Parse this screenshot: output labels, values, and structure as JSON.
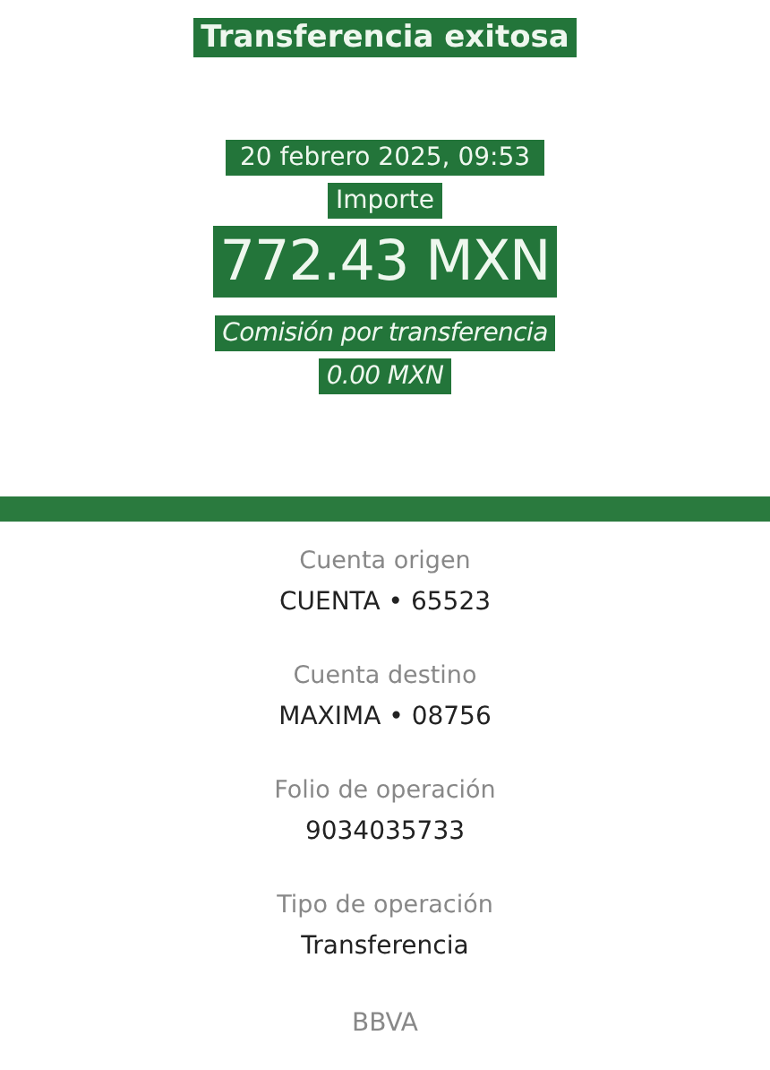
{
  "header": {
    "title": "Transferencia exitosa",
    "date": "20 febrero 2025, 09:53",
    "amount_label": "Importe",
    "amount": "772.43 MXN",
    "fee_label": "Comisión por transferencia",
    "fee": "0.00 MXN"
  },
  "details": [
    {
      "label": "Cuenta origen",
      "value": "CUENTA • 65523"
    },
    {
      "label": "Cuenta destino",
      "value": "MAXIMA • 08756"
    },
    {
      "label": "Folio de operación",
      "value": "9034035733"
    },
    {
      "label": "Tipo de operación",
      "value": "Transferencia"
    }
  ],
  "footer": "BBVA"
}
